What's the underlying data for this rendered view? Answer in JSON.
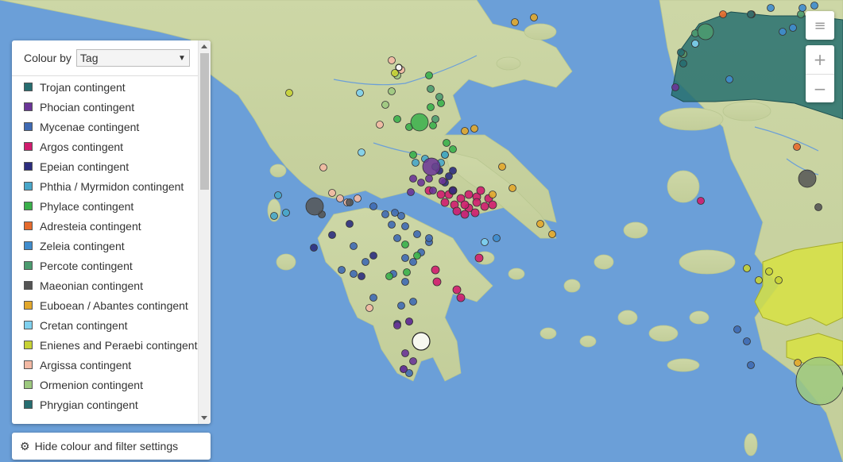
{
  "colour_by": {
    "label": "Colour by",
    "selected": "Tag"
  },
  "legend": [
    {
      "label": "Trojan contingent",
      "color": "#276d70"
    },
    {
      "label": "Phocian contingent",
      "color": "#6a3597"
    },
    {
      "label": "Mycenae contingent",
      "color": "#3f6ab3"
    },
    {
      "label": "Argos contingent",
      "color": "#d01c6e"
    },
    {
      "label": "Epeian contingent",
      "color": "#2c2d7e"
    },
    {
      "label": "Phthia / Myrmidon contingent",
      "color": "#48a6c9"
    },
    {
      "label": "Phylace contingent",
      "color": "#3ab04b"
    },
    {
      "label": "Adresteia contingent",
      "color": "#e56a2c"
    },
    {
      "label": "Zeleia contingent",
      "color": "#3f8ccd"
    },
    {
      "label": "Percote contingent",
      "color": "#4c9b6f"
    },
    {
      "label": "Maeonian contingent",
      "color": "#555555"
    },
    {
      "label": "Euboean / Abantes contingent",
      "color": "#e2a72c"
    },
    {
      "label": "Cretan contingent",
      "color": "#7fd0ee"
    },
    {
      "label": "Enienes and Peraebi contingent",
      "color": "#c7d235"
    },
    {
      "label": "Argissa contingent",
      "color": "#f3b9a4"
    },
    {
      "label": "Ormenion contingent",
      "color": "#9dc97f"
    },
    {
      "label": "Phrygian contingent",
      "color": "#276d70"
    }
  ],
  "hide_button": {
    "label": "Hide colour and filter settings",
    "icon": "gear-icon"
  },
  "map_controls": {
    "menu_icon": "hamburger-icon",
    "zoom_in": "+",
    "zoom_out": "−"
  },
  "colors": {
    "sea": "#6b9fd8",
    "land": "#c9d4a3",
    "trojan_region": "#27706e",
    "phrygian_region": "#d7e242"
  }
}
